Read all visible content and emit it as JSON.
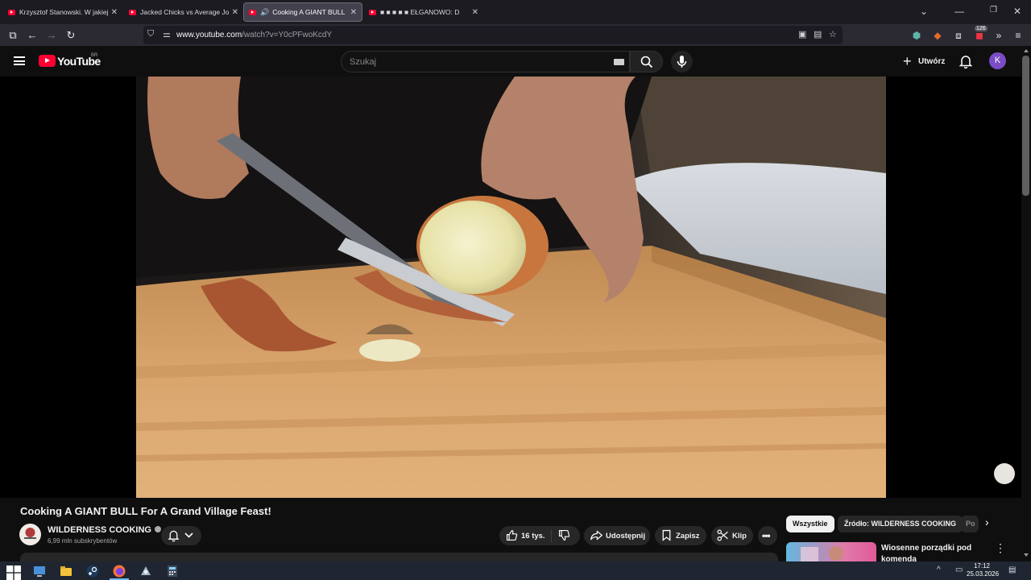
{
  "browser": {
    "tabs": [
      {
        "title": "Krzysztof Stanowski. W jakiej sy",
        "active": false
      },
      {
        "title": "Jacked Chicks vs Average Joes |",
        "active": false
      },
      {
        "title": "Cooking A GIANT BULL For",
        "active": true
      },
      {
        "title": "■ ■ ■ ■ ■ EŁGANOWO: D",
        "active": false
      }
    ],
    "url_domain": "www.youtube.com",
    "url_path": "/watch?v=Y0cPFwoKcdY",
    "extension_badge": "126",
    "icons": [
      "new-tab-icon",
      "back-icon",
      "forward-icon",
      "reload-icon",
      "shield-icon",
      "permissions-icon",
      "pip-icon",
      "reader-icon",
      "bookmark-star-icon",
      "extension-shield-icon",
      "extension-fox-icon",
      "extensions-icon",
      "overflow-icon",
      "menu-icon",
      "minimize-icon",
      "restore-icon",
      "close-icon",
      "tab-list-icon"
    ]
  },
  "youtube": {
    "logo_text": "YouTube",
    "region": "BR",
    "search_placeholder": "Szukaj",
    "create_label": "Utwórz",
    "avatar_letter": "K",
    "accent_color": "#ff0033"
  },
  "video": {
    "title": "Cooking A GIANT BULL For A Grand Village Feast!",
    "channel": "WILDERNESS COOKING",
    "subscribers": "6,99 mln subskrybentów",
    "likes": "16 tys.",
    "share_label": "Udostępnij",
    "save_label": "Zapisz",
    "clip_label": "Klip"
  },
  "sidebar": {
    "chips": [
      "Wszystkie",
      "Źródło: WILDERNESS COOKING",
      "Po"
    ],
    "rec_title": "Wiosenne porządki pod komenda"
  },
  "taskbar": {
    "time": "17:12",
    "date": "25.03.2026",
    "apps": [
      "windows-start-icon",
      "explorer-icon",
      "files-icon",
      "steam-icon",
      "firefox-icon",
      "app-icon",
      "calculator-icon"
    ]
  }
}
